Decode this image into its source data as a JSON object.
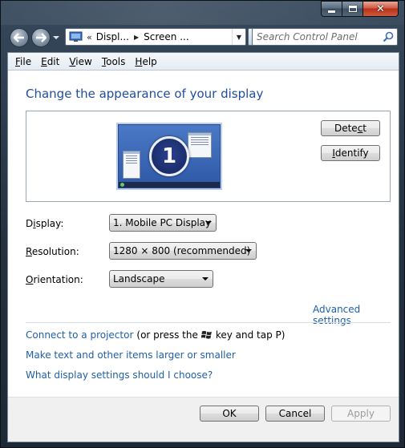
{
  "window": {
    "caption_buttons": {
      "minimize_icon": "minimize-icon",
      "maximize_icon": "maximize-icon",
      "close_icon": "close-icon"
    }
  },
  "address_bar": {
    "chevron": "«",
    "segments": [
      "Displ...",
      "Screen ..."
    ],
    "search_placeholder": "Search Control Panel"
  },
  "menu": {
    "items": [
      {
        "accel": "F",
        "rest": "ile"
      },
      {
        "accel": "E",
        "rest": "dit"
      },
      {
        "accel": "V",
        "rest": "iew"
      },
      {
        "accel": "T",
        "rest": "ools"
      },
      {
        "accel": "H",
        "rest": "elp"
      }
    ]
  },
  "content": {
    "title": "Change the appearance of your display",
    "monitor_number": "1",
    "detect_button": {
      "before": "Dete",
      "accel": "c",
      "after": "t"
    },
    "identify_button": {
      "before": "",
      "accel": "I",
      "after": "dentify"
    },
    "settings": {
      "display": {
        "label_before": "D",
        "label_accel": "i",
        "label_after": "splay:",
        "value": "1. Mobile PC Display"
      },
      "resolution": {
        "label_before": "",
        "label_accel": "R",
        "label_after": "esolution:",
        "value": "1280 × 800 (recommended)"
      },
      "orientation": {
        "label_before": "",
        "label_accel": "O",
        "label_after": "rientation:",
        "value": "Landscape"
      }
    },
    "advanced_link": "Advanced settings",
    "links": {
      "projector_link": "Connect to a projector",
      "projector_suffix_before": "(or press the",
      "projector_suffix_after": "key and tap P)",
      "text_size": "Make text and other items larger or smaller",
      "help": "What display settings should I choose?"
    }
  },
  "footer": {
    "ok": "OK",
    "cancel": "Cancel",
    "apply": "Apply"
  },
  "colors": {
    "link": "#1f5fa8",
    "title": "#1f4e9c",
    "frame": "#24313f"
  }
}
